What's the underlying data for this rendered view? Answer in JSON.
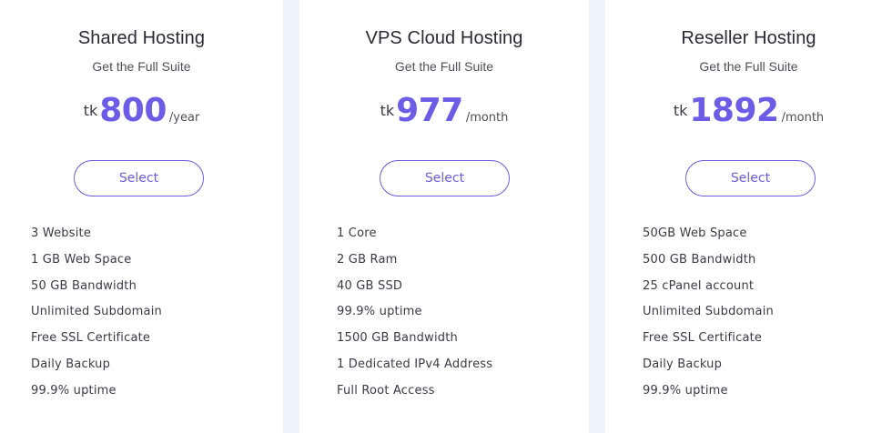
{
  "plans": [
    {
      "title": "Shared Hosting",
      "subtitle": "Get the Full Suite",
      "currency": "tk",
      "amount": "800",
      "period": "/year",
      "button_label": "Select",
      "features": [
        "3 Website",
        "1 GB Web Space",
        "50 GB Bandwidth",
        "Unlimited Subdomain",
        "Free SSL Certificate",
        "Daily Backup",
        "99.9% uptime"
      ]
    },
    {
      "title": "VPS Cloud Hosting",
      "subtitle": "Get the Full Suite",
      "currency": "tk",
      "amount": "977",
      "period": "/month",
      "button_label": "Select",
      "features": [
        "1 Core",
        "2 GB Ram",
        "40 GB SSD",
        "99.9% uptime",
        "1500 GB Bandwidth",
        "1 Dedicated IPv4 Address",
        "Full Root Access"
      ]
    },
    {
      "title": "Reseller Hosting",
      "subtitle": "Get the Full Suite",
      "currency": "tk",
      "amount": "1892",
      "period": "/month",
      "button_label": "Select",
      "features": [
        "50GB Web Space",
        "500 GB Bandwidth",
        "25 cPanel account",
        "Unlimited Subdomain",
        "Free SSL Certificate",
        "Daily Backup",
        "99.9% uptime"
      ]
    }
  ],
  "colors": {
    "accent": "#6c5ce7",
    "page_background": "#eef5fc",
    "card_background": "#ffffff",
    "title_text": "#2a2a33",
    "body_text": "#3a3a44"
  }
}
